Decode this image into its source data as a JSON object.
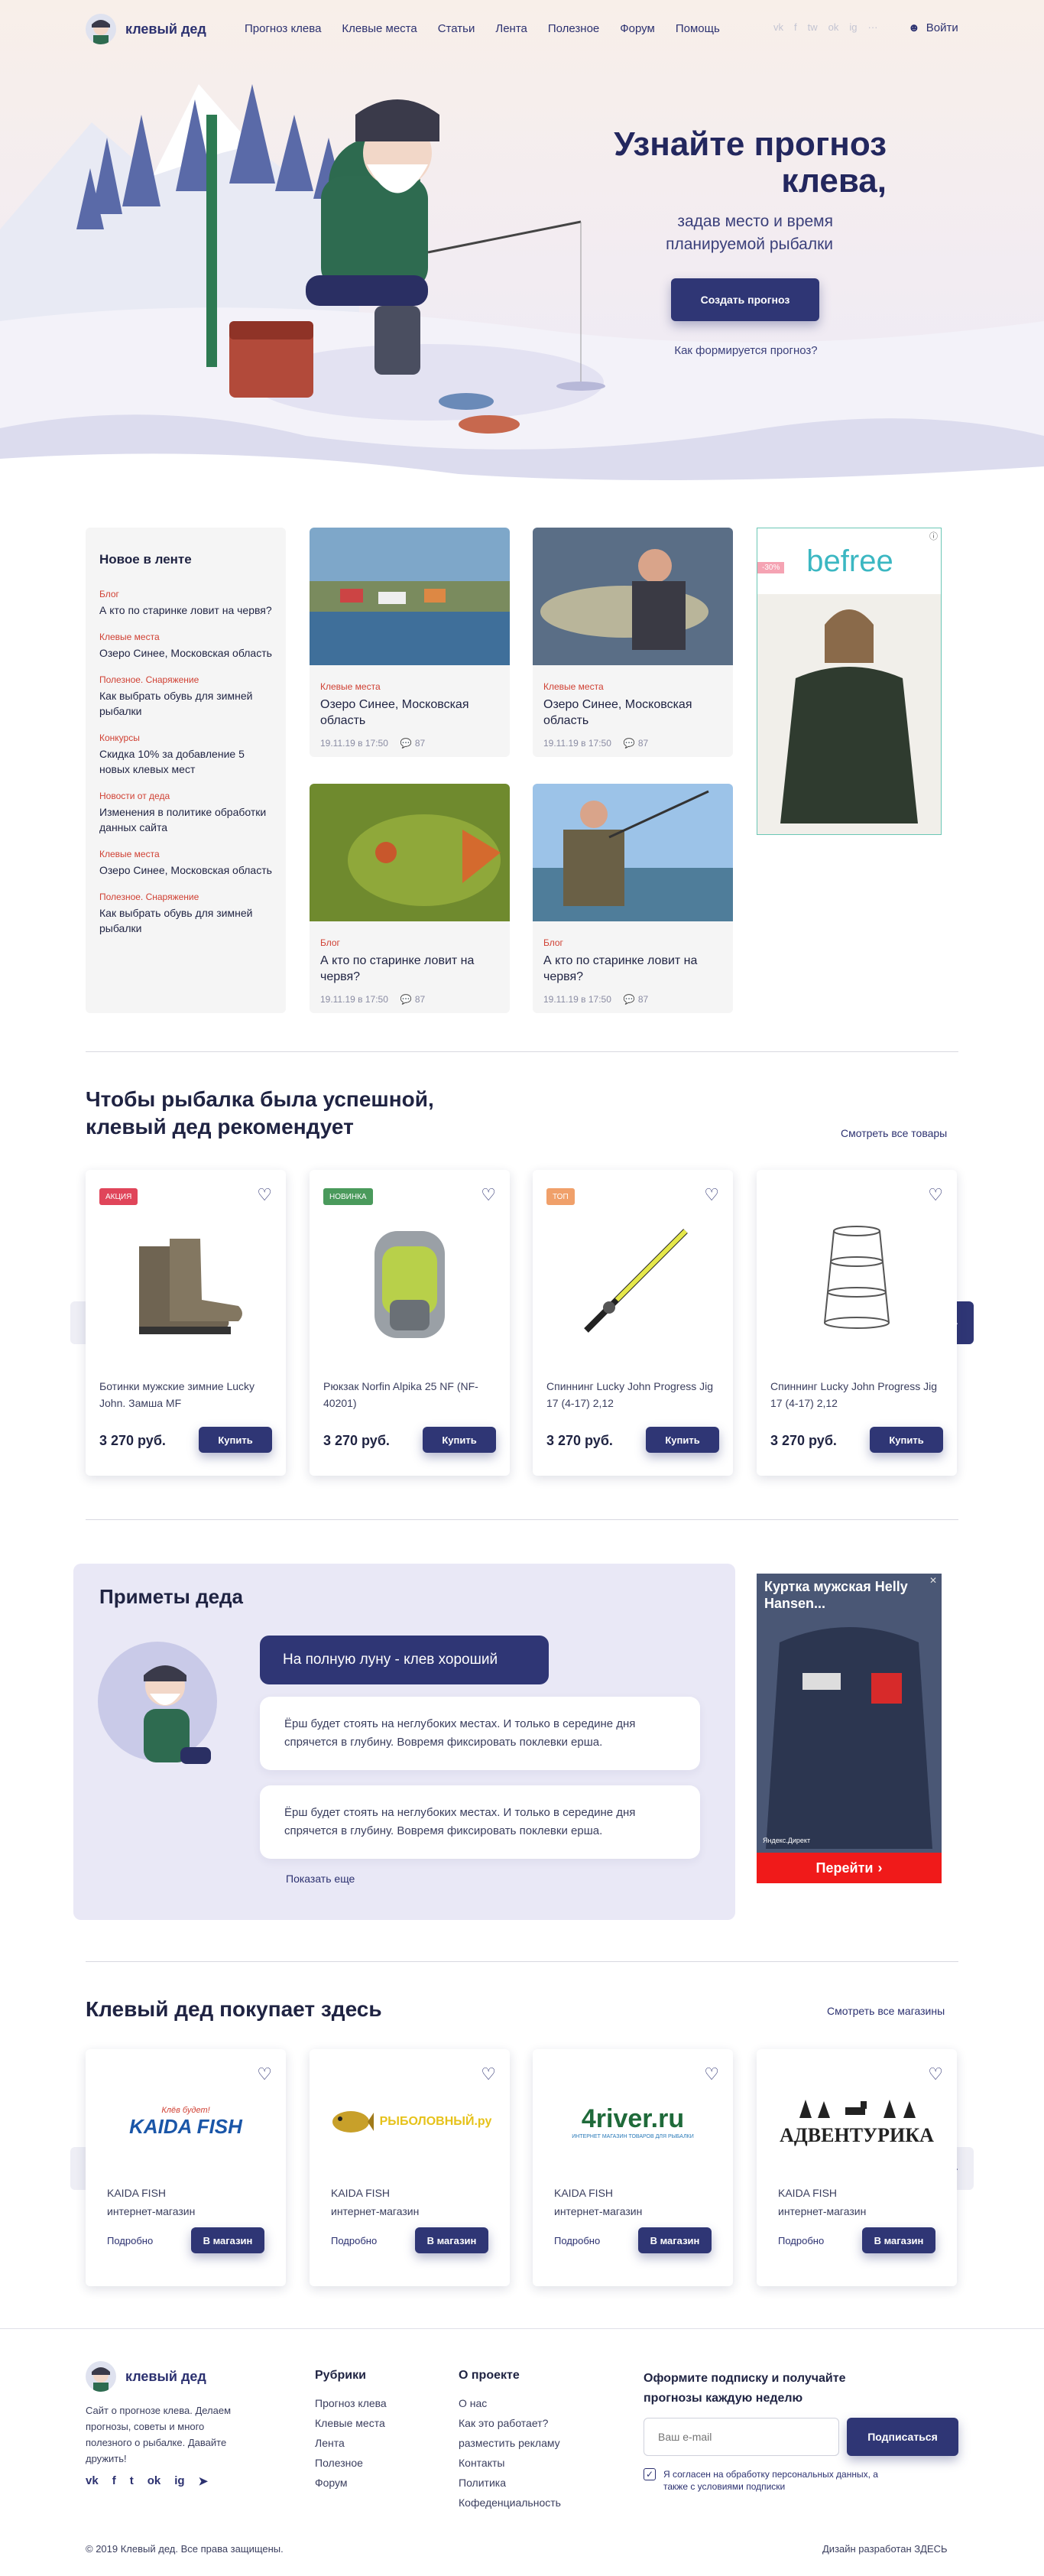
{
  "header": {
    "logo_text": "клевый дед",
    "nav": [
      "Прогноз клева",
      "Клевые места",
      "Статьи",
      "Лента",
      "Полезное",
      "Форум",
      "Помощь"
    ],
    "social": [
      "vk",
      "f",
      "tw",
      "ok",
      "ig",
      "..."
    ],
    "login": "Войти"
  },
  "hero": {
    "title": "Узнайте прогноз клева,",
    "subtitle": "задав место и время планируемой рыбалки",
    "button": "Создать прогноз",
    "link": "Как формируется прогноз?"
  },
  "feed": {
    "title": "Новое в ленте",
    "items": [
      {
        "cat": "Блог",
        "text": "А кто по старинке ловит на червя?"
      },
      {
        "cat": "Клевые места",
        "text": "Озеро Синее, Московская область"
      },
      {
        "cat": "Полезное. Снаряжение",
        "text": "Как выбрать обувь для зимней рыбалки"
      },
      {
        "cat": "Конкурсы",
        "text": "Скидка 10% за добавление 5 новых клевых мест"
      },
      {
        "cat": "Новости от деда",
        "text": "Изменения в политике обработки данных сайта"
      },
      {
        "cat": "Клевые места",
        "text": "Озеро Синее, Московская область"
      },
      {
        "cat": "Полезное. Снаряжение",
        "text": "Как выбрать обувь для зимней рыбалки"
      }
    ]
  },
  "news": [
    {
      "cat": "Клевые места",
      "title": "Озеро Синее, Московская область",
      "date": "19.11.19 в 17:50",
      "comments": "87"
    },
    {
      "cat": "Клевые места",
      "title": "Озеро Синее, Московская область",
      "date": "19.11.19 в 17:50",
      "comments": "87"
    },
    {
      "cat": "Блог",
      "title": "А кто по старинке ловит на червя?",
      "date": "19.11.19 в 17:50",
      "comments": "87"
    },
    {
      "cat": "Блог",
      "title": "А кто по старинке ловит на червя?",
      "date": "19.11.19 в 17:50",
      "comments": "87"
    }
  ],
  "ad1": {
    "brand": "befree",
    "badge": "-30%"
  },
  "products_section": {
    "title_line1": "Чтобы рыбалка была успешной,",
    "title_line2": "клевый дед рекомендует",
    "link": "Смотреть все товары",
    "items": [
      {
        "badge": "АКЦИЯ",
        "badge_color": "#e0455a",
        "name": "Ботинки мужские зимние Lucky John. Замша MF",
        "price": "3 270 руб.",
        "buy": "Купить"
      },
      {
        "badge": "НОВИНКА",
        "badge_color": "#4a9a5c",
        "name": "Рюкзак Norfin Alpika 25 NF (NF-40201)",
        "price": "3 270 руб.",
        "buy": "Купить"
      },
      {
        "badge": "ТОП",
        "badge_color": "#f0a06a",
        "name": "Спиннинг Lucky John Progress Jig 17 (4-17) 2,12",
        "price": "3 270 руб.",
        "buy": "Купить"
      },
      {
        "badge": "",
        "badge_color": "",
        "name": "Спиннинг Lucky John Progress Jig 17 (4-17) 2,12",
        "price": "3 270 руб.",
        "buy": "Купить"
      }
    ]
  },
  "omens": {
    "title": "Приметы деда",
    "headline": "На полную луну - клев хороший",
    "texts": [
      "Ёрш будет стоять на неглубоких местах. И только в середине дня спрячется в глубину. Вовремя фиксировать поклевки ерша.",
      "Ёрш будет стоять на неглубоких местах. И только в середине дня спрячется в глубину. Вовремя фиксировать поклевки ерша."
    ],
    "more": "Показать еще"
  },
  "ad2": {
    "title": "Куртка мужская Helly Hansen...",
    "source": "Яндекс.Директ",
    "button": "Перейти"
  },
  "shops_section": {
    "title": "Клевый дед покупает здесь",
    "link": "Смотреть все магазины",
    "items": [
      {
        "logo": "KAIDA FISH",
        "logo_top": "Клёв будет!",
        "name": "KAIDA FISH",
        "type": "интернет-магазин",
        "more": "Подробно",
        "btn": "В магазин"
      },
      {
        "logo": "РЫБОЛОВНЫЙ.ру",
        "logo_top": "",
        "name": "KAIDA FISH",
        "type": "интернет-магазин",
        "more": "Подробно",
        "btn": "В магазин"
      },
      {
        "logo": "4river.ru",
        "logo_top": "ИНТЕРНЕТ МАГАЗИН ТОВАРОВ ДЛЯ РЫБАЛКИ",
        "name": "KAIDA FISH",
        "type": "интернет-магазин",
        "more": "Подробно",
        "btn": "В магазин"
      },
      {
        "logo": "АДВЕНТУРИКА",
        "logo_top": "",
        "name": "KAIDA FISH",
        "type": "интернет-магазин",
        "more": "Подробно",
        "btn": "В магазин"
      }
    ]
  },
  "footer": {
    "logo_text": "клевый дед",
    "about": "Сайт о прогнозе клева. Делаем прогнозы, советы и много полезного о рыбалке. Давайте дружить!",
    "rubrics_title": "Рубрики",
    "rubrics": [
      "Прогноз клева",
      "Клевые места",
      "Лента",
      "Полезное",
      "Форум"
    ],
    "project_title": "О проекте",
    "project": [
      "О нас",
      "Как это работает?",
      "разместить рекламу",
      "Контакты",
      "Политика",
      "Кофеденциальность"
    ],
    "subscribe_title": "Оформите подписку и получайте прогнозы каждую неделю",
    "email_placeholder": "Ваш e-mail",
    "subscribe_btn": "Подписаться",
    "agree": "Я согласен на обработку персональных данных, а также с условиями подписки",
    "copyright": "© 2019 Клевый дед. Все права защищены.",
    "dev": "Дизайн разработан ЗДЕСЬ"
  }
}
